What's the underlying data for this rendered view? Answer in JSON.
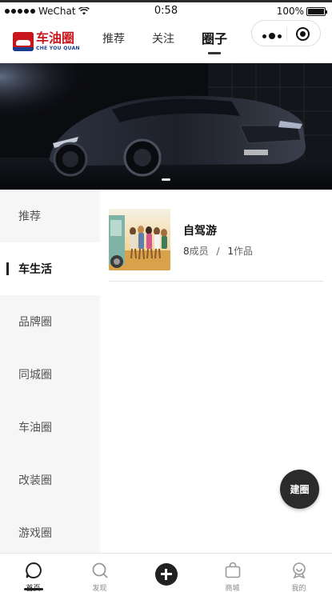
{
  "status_bar": {
    "carrier": "WeChat",
    "time": "0:58",
    "battery": "100%"
  },
  "nav": {
    "logo_cn": "车油圈",
    "logo_en": "CHE YOU QUAN",
    "tabs": [
      {
        "label": "推荐",
        "active": false
      },
      {
        "label": "关注",
        "active": false
      },
      {
        "label": "圈子",
        "active": true
      }
    ]
  },
  "banner": {
    "slide_count": 1,
    "active_slide": 1
  },
  "sidebar": {
    "items": [
      {
        "label": "推荐",
        "active": false
      },
      {
        "label": "车生活",
        "active": true
      },
      {
        "label": "品牌圈",
        "active": false
      },
      {
        "label": "同城圈",
        "active": false
      },
      {
        "label": "车油圈",
        "active": false
      },
      {
        "label": "改装圈",
        "active": false
      },
      {
        "label": "游戏圈",
        "active": false
      }
    ]
  },
  "circles": [
    {
      "name": "自驾游",
      "members_count": "8",
      "members_label": "成员",
      "separator": "/",
      "works_count": "1",
      "works_label": "作品"
    }
  ],
  "fab": {
    "label": "建圈"
  },
  "bottom_tabs": [
    {
      "label": "首页",
      "icon": "home-chat-icon",
      "active": true
    },
    {
      "label": "发现",
      "icon": "search-icon",
      "active": false
    },
    {
      "label": "",
      "icon": "plus-icon",
      "active": false
    },
    {
      "label": "商城",
      "icon": "shopping-bag-icon",
      "active": false
    },
    {
      "label": "我的",
      "icon": "profile-icon",
      "active": false
    }
  ],
  "colors": {
    "brand_red": "#c8161d",
    "brand_blue": "#1b3f8f",
    "dark": "#2b2b2b",
    "sidebar_bg": "#f6f6f6"
  }
}
